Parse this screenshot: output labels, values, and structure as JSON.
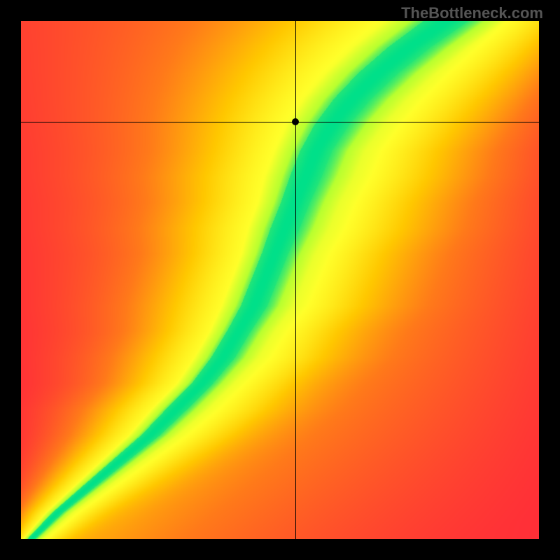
{
  "watermark": "TheBottleneck.com",
  "chart_data": {
    "type": "heatmap",
    "title": "",
    "xlabel": "",
    "ylabel": "",
    "xlim": [
      0,
      1
    ],
    "ylim": [
      0,
      1
    ],
    "crosshair": {
      "x": 0.53,
      "y": 0.805
    },
    "marker": {
      "x": 0.53,
      "y": 0.805
    },
    "color_stops": [
      {
        "t": 0.0,
        "color": "#ff2a3a"
      },
      {
        "t": 0.35,
        "color": "#ff7a1a"
      },
      {
        "t": 0.6,
        "color": "#ffc800"
      },
      {
        "t": 0.8,
        "color": "#ffff2a"
      },
      {
        "t": 0.93,
        "color": "#b8ff30"
      },
      {
        "t": 1.0,
        "color": "#00e08a"
      }
    ],
    "ridge": {
      "comment": "approximate center line x as function of y (normalized 0..1)",
      "points": [
        {
          "y": 0.0,
          "x": 0.02,
          "w": 0.015
        },
        {
          "y": 0.05,
          "x": 0.07,
          "w": 0.02
        },
        {
          "y": 0.1,
          "x": 0.13,
          "w": 0.025
        },
        {
          "y": 0.15,
          "x": 0.19,
          "w": 0.03
        },
        {
          "y": 0.2,
          "x": 0.25,
          "w": 0.035
        },
        {
          "y": 0.25,
          "x": 0.3,
          "w": 0.04
        },
        {
          "y": 0.3,
          "x": 0.35,
          "w": 0.04
        },
        {
          "y": 0.35,
          "x": 0.39,
          "w": 0.045
        },
        {
          "y": 0.4,
          "x": 0.42,
          "w": 0.045
        },
        {
          "y": 0.45,
          "x": 0.45,
          "w": 0.05
        },
        {
          "y": 0.5,
          "x": 0.47,
          "w": 0.05
        },
        {
          "y": 0.55,
          "x": 0.49,
          "w": 0.05
        },
        {
          "y": 0.6,
          "x": 0.51,
          "w": 0.055
        },
        {
          "y": 0.65,
          "x": 0.53,
          "w": 0.055
        },
        {
          "y": 0.7,
          "x": 0.55,
          "w": 0.06
        },
        {
          "y": 0.75,
          "x": 0.57,
          "w": 0.06
        },
        {
          "y": 0.8,
          "x": 0.6,
          "w": 0.065
        },
        {
          "y": 0.85,
          "x": 0.64,
          "w": 0.07
        },
        {
          "y": 0.9,
          "x": 0.69,
          "w": 0.075
        },
        {
          "y": 0.95,
          "x": 0.75,
          "w": 0.08
        },
        {
          "y": 1.0,
          "x": 0.82,
          "w": 0.085
        }
      ]
    },
    "side_gradient": {
      "comment": "background coloring away from ridge; left side red, right side yellow->orange",
      "left_bias": 0.25,
      "right_bias": 0.55
    }
  }
}
